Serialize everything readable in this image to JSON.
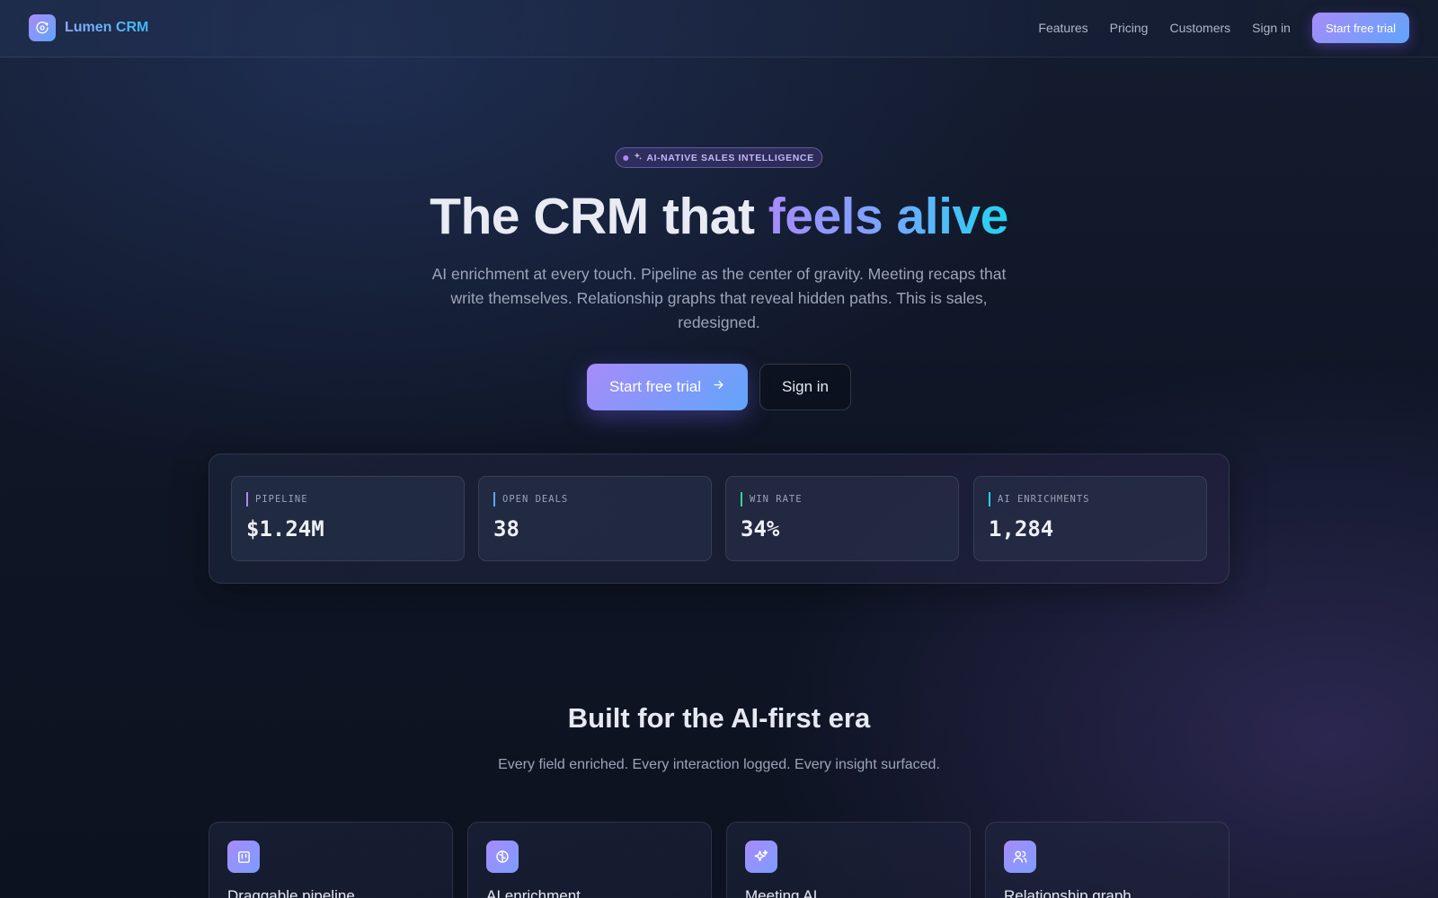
{
  "brand": {
    "name": "Lumen CRM",
    "logo_icon": "orbit-icon"
  },
  "nav": {
    "links": [
      "Features",
      "Pricing",
      "Customers",
      "Sign in"
    ],
    "cta": "Start free trial"
  },
  "hero": {
    "badge": "AI-NATIVE SALES INTELLIGENCE",
    "badge_icon": "sparkle-icon",
    "title_plain": "The CRM that ",
    "title_gradient": "feels alive",
    "subtitle": "AI enrichment at every touch. Pipeline as the center of gravity. Meeting recaps that write themselves. Relationship graphs that reveal hidden paths. This is sales, redesigned.",
    "primary_cta": "Start free trial",
    "secondary_cta": "Sign in"
  },
  "stats": [
    {
      "label": "PIPELINE",
      "value": "$1.24M",
      "accent": "#a78bfa"
    },
    {
      "label": "OPEN DEALS",
      "value": "38",
      "accent": "#60a5fa"
    },
    {
      "label": "WIN RATE",
      "value": "34%",
      "accent": "#34d399"
    },
    {
      "label": "AI ENRICHMENTS",
      "value": "1,284",
      "accent": "#22d3ee"
    }
  ],
  "features_section": {
    "title": "Built for the AI-first era",
    "subtitle": "Every field enriched. Every interaction logged. Every insight surfaced.",
    "cards": [
      {
        "title": "Draggable pipeline",
        "icon": "kanban-icon"
      },
      {
        "title": "AI enrichment",
        "icon": "brain-icon"
      },
      {
        "title": "Meeting AI",
        "icon": "sparkles-icon"
      },
      {
        "title": "Relationship graph",
        "icon": "users-icon"
      }
    ]
  },
  "colors": {
    "accent_purple": "#a78bfa",
    "accent_blue": "#60a5fa",
    "accent_cyan": "#22d3ee",
    "background": "#0f1626"
  }
}
